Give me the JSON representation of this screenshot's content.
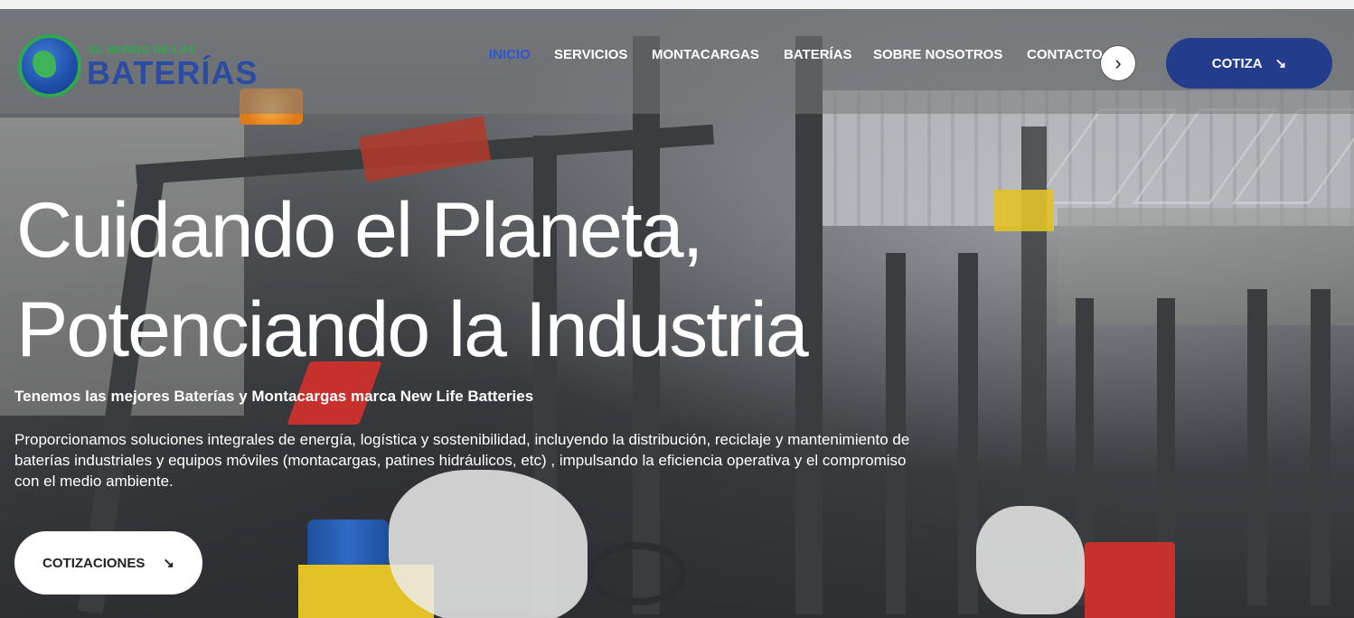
{
  "brand": {
    "logo_small": "EL MUNDO DE LAS",
    "logo_big": "BATERÍAS"
  },
  "nav": {
    "items": [
      {
        "label": "INICIO",
        "active": true
      },
      {
        "label": "SERVICIOS",
        "active": false
      },
      {
        "label": "MONTACARGAS",
        "active": false
      },
      {
        "label": "BATERÍAS",
        "active": false
      },
      {
        "label": "SOBRE NOSOTROS",
        "active": false
      },
      {
        "label": "CONTACTO",
        "active": false
      }
    ],
    "next_icon": "chevron-right-icon",
    "cta_label": "COTIZA",
    "cta_icon": "arrow-down-right-icon"
  },
  "hero": {
    "headline_line1": "Cuidando el Planeta,",
    "headline_line2": "Potenciando la Industria",
    "subtitle": "Tenemos las mejores Baterías y Montacargas marca New Life Batteries",
    "description": "Proporcionamos soluciones integrales de energía, logística y sostenibilidad, incluyendo la distribución, reciclaje y mantenimiento de baterías industriales y equipos móviles (montacargas, patines hidráulicos, etc) , impulsando la eficiencia operativa y el compromiso con el medio ambiente.",
    "cta_label": "COTIZACIONES",
    "cta_icon": "arrow-down-right-icon"
  },
  "colors": {
    "accent_blue": "#233c8c",
    "active_nav": "#2f54d8",
    "logo_green": "#2fa84f",
    "logo_blue": "#2a4da3"
  }
}
